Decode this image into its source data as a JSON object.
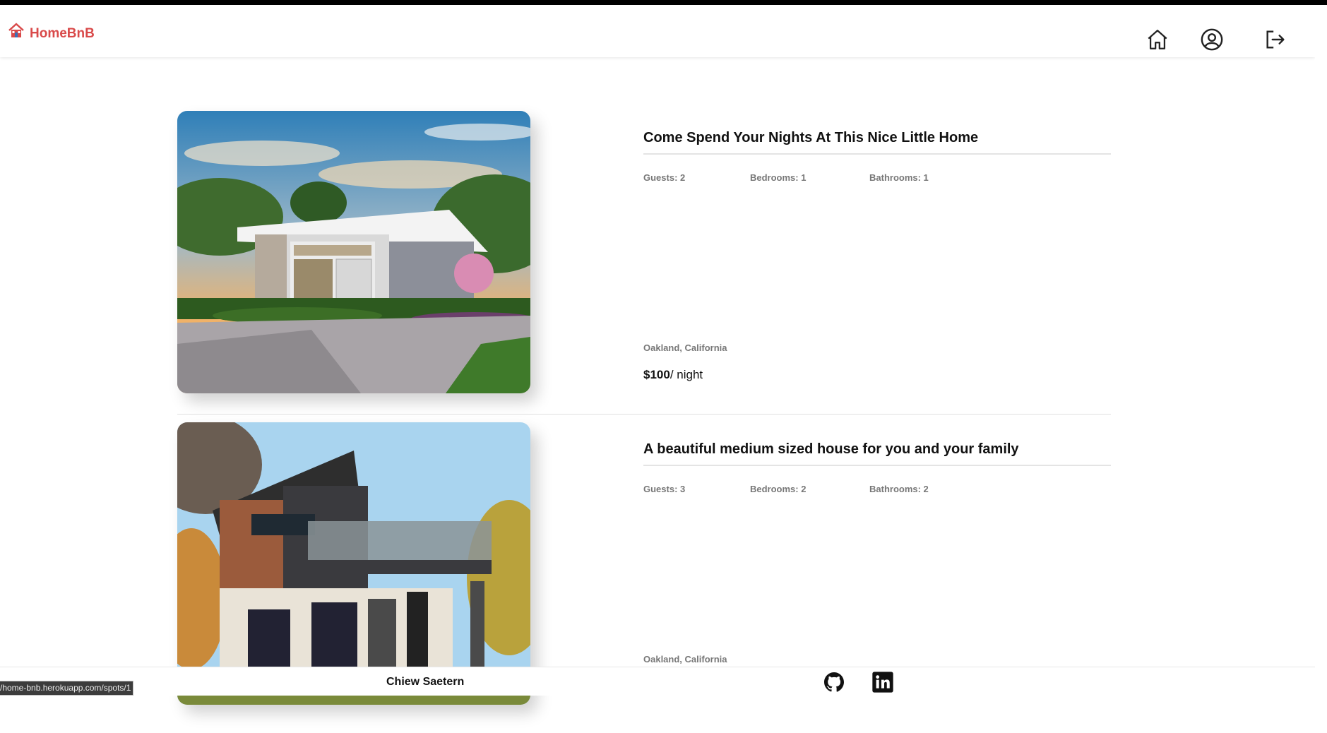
{
  "header": {
    "brand": "HomeBnB",
    "icons": [
      "house-icon",
      "user-circle-icon",
      "logout-icon"
    ]
  },
  "listings": [
    {
      "title": "Come Spend Your Nights At This Nice Little Home",
      "guests": "Guests: 2",
      "bedrooms": "Bedrooms: 1",
      "bathrooms": "Bathrooms: 1",
      "location": "Oakland, California",
      "price": "$100",
      "price_unit": "/ night"
    },
    {
      "title": "A beautiful medium sized house for you and your family",
      "guests": "Guests: 3",
      "bedrooms": "Bedrooms: 2",
      "bathrooms": "Bathrooms: 2",
      "location": "Oakland, California"
    }
  ],
  "footer": {
    "name": "Chiew Saetern",
    "icons": [
      "github-icon",
      "linkedin-icon"
    ]
  },
  "status_bar": {
    "url": "/home-bnb.herokuapp.com/spots/1"
  },
  "colors": {
    "brand": "#d94a4a",
    "muted_text": "#777777",
    "rule": "#e4e4e4"
  }
}
